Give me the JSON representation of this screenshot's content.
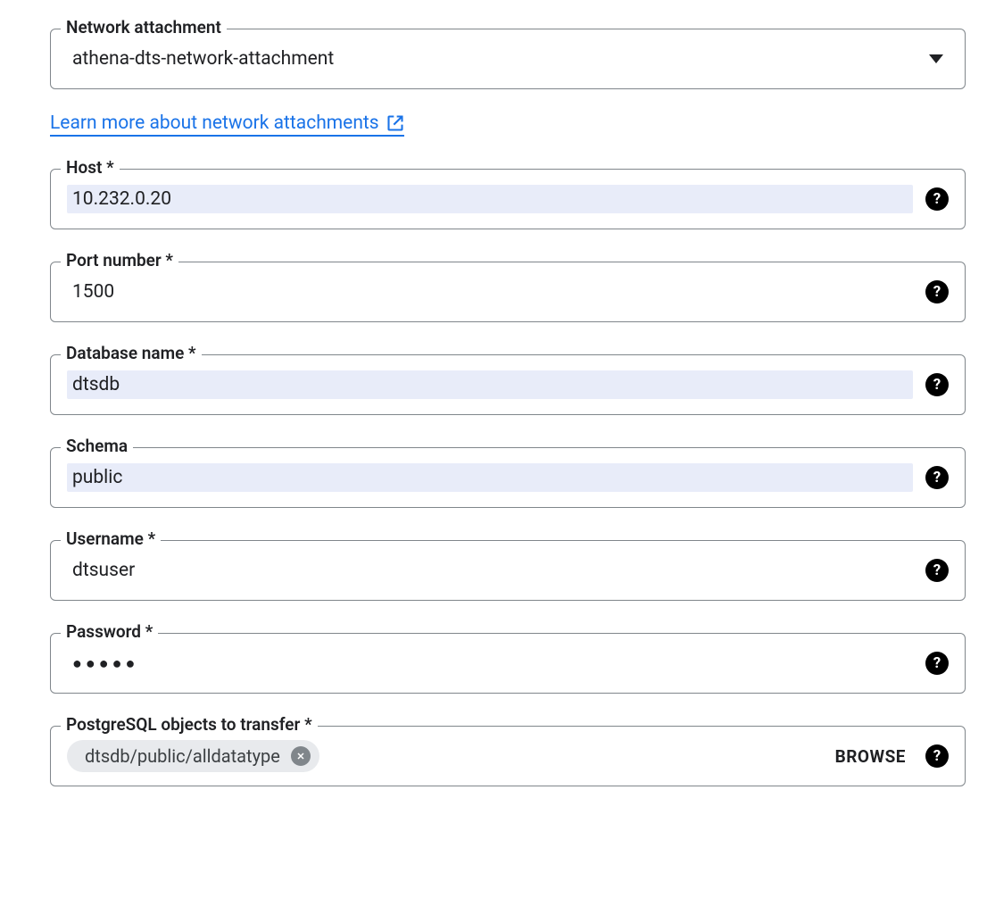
{
  "network_attachment": {
    "label": "Network attachment",
    "value": "athena-dts-network-attachment"
  },
  "learn_more": {
    "text": "Learn more about network attachments"
  },
  "host": {
    "label": "Host *",
    "value": "10.232.0.20"
  },
  "port": {
    "label": "Port number *",
    "value": "1500"
  },
  "database_name": {
    "label": "Database name *",
    "value": "dtsdb"
  },
  "schema": {
    "label": "Schema",
    "value": "public"
  },
  "username": {
    "label": "Username *",
    "value": "dtsuser"
  },
  "password": {
    "label": "Password *",
    "masked_value": "●●●●●"
  },
  "objects": {
    "label": "PostgreSQL objects to transfer *",
    "chip": "dtsdb/public/alldatatype",
    "browse_label": "BROWSE"
  }
}
